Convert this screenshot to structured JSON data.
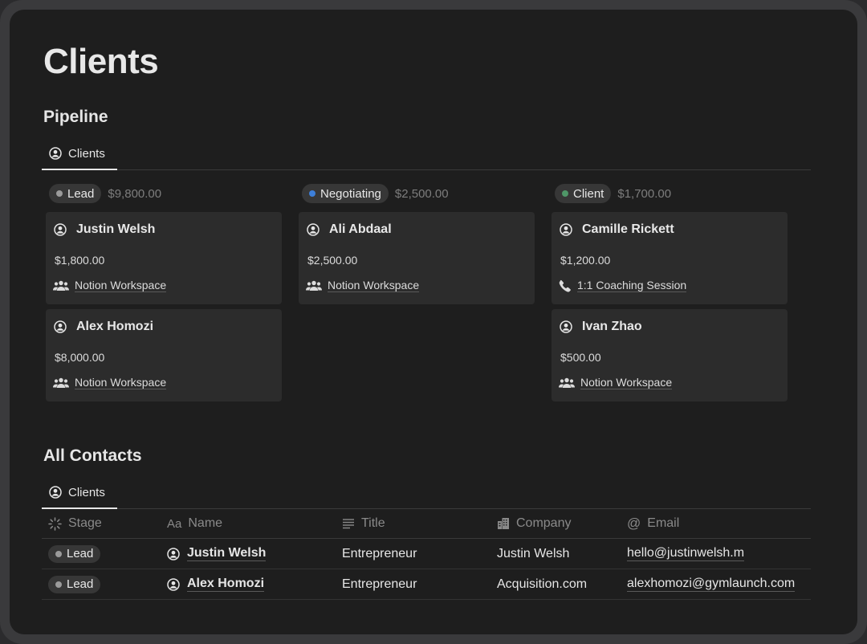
{
  "page": {
    "title": "Clients"
  },
  "pipeline": {
    "title": "Pipeline",
    "view_tab": {
      "label": "Clients",
      "icon": "user-circle-icon"
    },
    "columns": [
      {
        "status": "Lead",
        "dot_color": "#9b9b9b",
        "sum": "$9,800.00",
        "cards": [
          {
            "name": "Justin Welsh",
            "amount": "$1,800.00",
            "relation": "Notion Workspace",
            "relation_icon": "people-icon"
          },
          {
            "name": "Alex Homozi",
            "amount": "$8,000.00",
            "relation": "Notion Workspace",
            "relation_icon": "people-icon"
          }
        ]
      },
      {
        "status": "Negotiating",
        "dot_color": "#3d7fd9",
        "sum": "$2,500.00",
        "cards": [
          {
            "name": "Ali Abdaal",
            "amount": "$2,500.00",
            "relation": "Notion Workspace",
            "relation_icon": "people-icon"
          }
        ]
      },
      {
        "status": "Client",
        "dot_color": "#4f9768",
        "sum": "$1,700.00",
        "cards": [
          {
            "name": "Camille Rickett",
            "amount": "$1,200.00",
            "relation": "1:1 Coaching Session",
            "relation_icon": "phone-icon"
          },
          {
            "name": "Ivan Zhao",
            "amount": "$500.00",
            "relation": "Notion Workspace",
            "relation_icon": "people-icon"
          }
        ]
      }
    ]
  },
  "contacts": {
    "title": "All Contacts",
    "view_tab": {
      "label": "Clients",
      "icon": "user-circle-icon"
    },
    "columns": [
      {
        "label": "Stage",
        "icon": "loader-icon"
      },
      {
        "label": "Name",
        "icon": "text-aa-icon",
        "icon_text": "Aa"
      },
      {
        "label": "Title",
        "icon": "lines-icon"
      },
      {
        "label": "Company",
        "icon": "building-icon"
      },
      {
        "label": "Email",
        "icon": "at-icon",
        "icon_text": "@"
      }
    ],
    "rows": [
      {
        "stage": "Lead",
        "name": "Justin Welsh",
        "title": "Entrepreneur",
        "company": "Justin Welsh",
        "email": "hello@justinwelsh.m"
      },
      {
        "stage": "Lead",
        "name": "Alex Homozi",
        "title": "Entrepreneur",
        "company": "Acquisition.com",
        "email": "alexhomozi@gymlaunch.com"
      }
    ]
  },
  "colors": {
    "background": "#1e1e1e",
    "card": "#2c2c2c",
    "pill": "#373737",
    "muted": "#7d7d7d"
  }
}
